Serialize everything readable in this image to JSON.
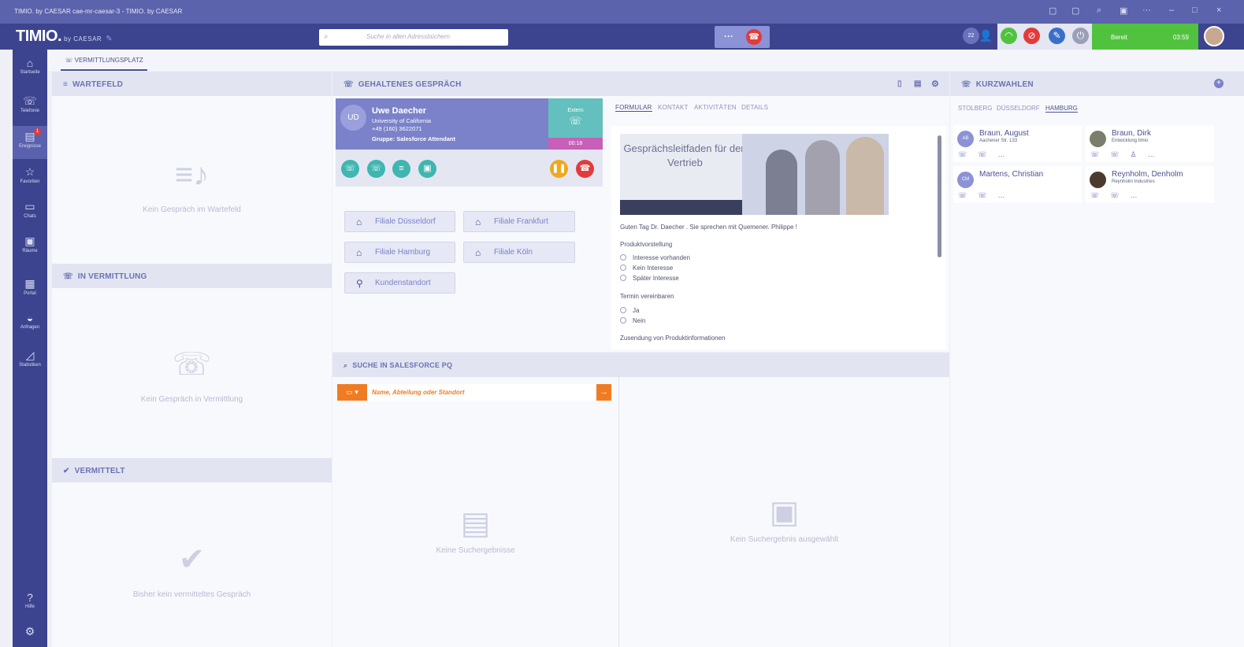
{
  "window": {
    "title": "TIMIO. by CAESAR cae-mr-caesar-3 - TIMIO. by CAESAR",
    "controls": [
      "▢",
      "▢",
      "⌕",
      "▣",
      "···",
      "–",
      "□",
      "×"
    ]
  },
  "brand": {
    "name": "TIMIO.",
    "sub": "by CAESAR"
  },
  "search": {
    "placeholder": "Suche in allen Adressbüchern"
  },
  "top": {
    "more": "···",
    "badge": "22",
    "status_label": "Bereit",
    "status_time": "03:59"
  },
  "sidebar": {
    "items": [
      {
        "label": "Startseite",
        "icon": "⌂"
      },
      {
        "label": "Telefonie",
        "icon": "☏"
      },
      {
        "label": "Ereignisse",
        "icon": "▤",
        "badge": "1"
      },
      {
        "label": "Favoriten",
        "icon": "☆"
      },
      {
        "label": "Chats",
        "icon": "▭"
      },
      {
        "label": "Räume",
        "icon": "▣"
      },
      {
        "label": "Portal",
        "icon": "▦"
      },
      {
        "label": "Anfragen",
        "icon": "◒"
      },
      {
        "label": "Statistiken",
        "icon": "◿"
      },
      {
        "label": "Hilfe",
        "icon": "?"
      },
      {
        "label": "",
        "icon": "⚙"
      }
    ]
  },
  "tab": {
    "label": "VERMITTLUNGSPLATZ"
  },
  "wartefeld": {
    "title": "WARTEFELD",
    "empty": "Kein Gespräch im Wartefeld"
  },
  "invermittlung": {
    "title": "IN VERMITTLUNG",
    "empty": "Kein Gespräch in Vermittlung"
  },
  "vermittelt": {
    "title": "VERMITTELT",
    "empty": "Bisher kein vermitteltes Gespräch"
  },
  "held": {
    "title": "GEHALTENES GESPRÄCH",
    "caller": {
      "initials": "UD",
      "name": "Uwe Daecher",
      "org": "University of California",
      "phone": "+49 (160) 3622071",
      "group": "Gruppe: Salesforce Attendant"
    },
    "extern": "Extern",
    "timer": "00:18",
    "locations": [
      "Filiale Düsseldorf",
      "Filiale Frankfurt",
      "Filiale Hamburg",
      "Filiale Köln",
      "Kundenstandort"
    ]
  },
  "form": {
    "tabs": [
      "FORMULAR",
      "KONTAKT",
      "AKTIVITÄTEN",
      "DETAILS"
    ],
    "hero_title": "Gesprächsleitfaden für den Vertrieb",
    "greeting": "Guten Tag Dr. Daecher . Sie sprechen mit Quemener. Philippe !",
    "q1": "Produktvorstellung",
    "q1_opts": [
      "Interesse vorhanden",
      "Kein Interesse",
      "Später Interesse"
    ],
    "q2": "Termin vereinbaren",
    "q2_opts": [
      "Ja",
      "Nein"
    ],
    "q3": "Zusendung von Produktinformationen"
  },
  "sfsearch": {
    "title": "SUCHE IN SALESFORCE PQ",
    "placeholder": "Name, Abteilung oder Standort",
    "empty_results": "Keine Suchergebnisse",
    "empty_detail": "Kein Suchergebnis ausgewählt"
  },
  "speeddial": {
    "title": "KURZWAHLEN",
    "tabs": [
      "STOLBERG",
      "DÜSSELDORF",
      "HAMBURG"
    ],
    "contacts": [
      {
        "initials": "AB",
        "name": "Braun, August",
        "sub": "Aachener Str. 133"
      },
      {
        "initials": "",
        "name": "Braun, Dirk",
        "sub": "Entwicklung timio"
      },
      {
        "initials": "CM",
        "name": "Martens, Christian",
        "sub": ""
      },
      {
        "initials": "",
        "name": "Reynholm, Denholm",
        "sub": "Reynholm Industries"
      }
    ]
  },
  "colors": {
    "primary": "#3c448f",
    "accent": "#7b82c9",
    "green": "#51c23e",
    "orange": "#ef7c23",
    "red": "#e23b3b",
    "teal": "#63c0be"
  }
}
